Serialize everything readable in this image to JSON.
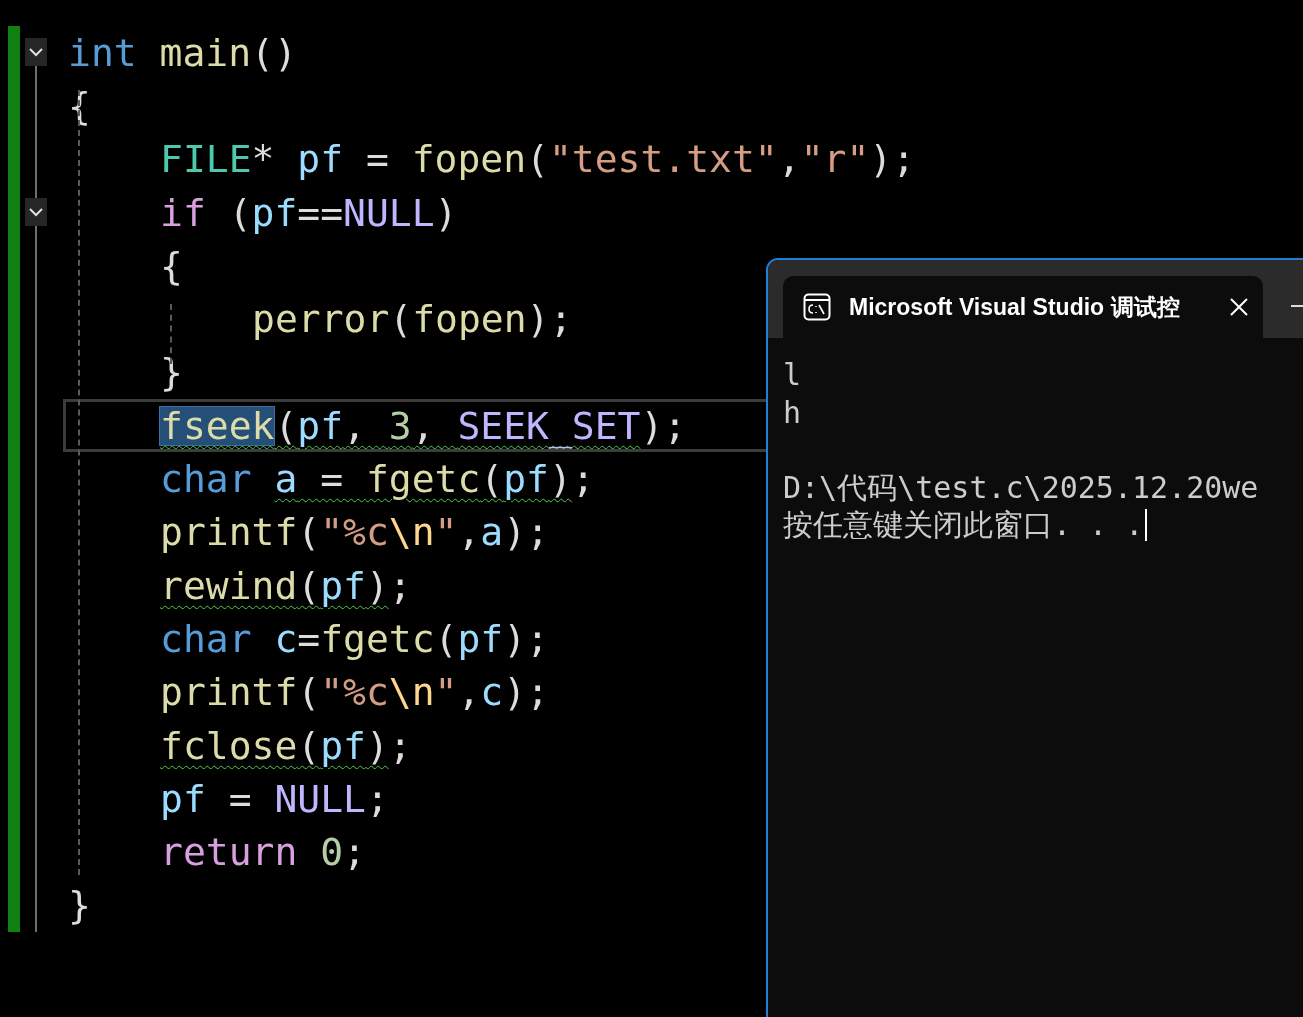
{
  "editor": {
    "lines": [
      {
        "expanded": true,
        "tokens": [
          {
            "text": "int ",
            "kind": "keyword"
          },
          {
            "text": "main",
            "kind": "function"
          },
          {
            "text": "()",
            "kind": "punct"
          }
        ]
      },
      {
        "tokens": [
          {
            "text": "{",
            "kind": "punct"
          }
        ],
        "children": [
          {
            "tokens": [
              {
                "text": "FILE",
                "kind": "type"
              },
              {
                "text": "* ",
                "kind": "punct"
              },
              {
                "text": "pf",
                "kind": "variable"
              },
              {
                "text": " = ",
                "kind": "punct"
              },
              {
                "text": "fopen",
                "kind": "function"
              },
              {
                "text": "(",
                "kind": "punct"
              },
              {
                "text": "\"test.txt\"",
                "kind": "string"
              },
              {
                "text": ",",
                "kind": "punct"
              },
              {
                "text": "\"r\"",
                "kind": "string"
              },
              {
                "text": ");",
                "kind": "punct"
              }
            ]
          },
          {
            "expanded": true,
            "tokens": [
              {
                "text": "if",
                "kind": "control"
              },
              {
                "text": " (",
                "kind": "punct"
              },
              {
                "text": "pf",
                "kind": "variable"
              },
              {
                "text": "==",
                "kind": "punct"
              },
              {
                "text": "NULL",
                "kind": "macro"
              },
              {
                "text": ")",
                "kind": "punct"
              }
            ]
          },
          {
            "tokens": [
              {
                "text": "{",
                "kind": "punct"
              }
            ],
            "children": [
              {
                "tokens": [
                  {
                    "text": "perror",
                    "kind": "function"
                  },
                  {
                    "text": "(",
                    "kind": "punct"
                  },
                  {
                    "text": "fopen",
                    "kind": "function"
                  },
                  {
                    "text": ");",
                    "kind": "punct"
                  }
                ]
              }
            ]
          },
          {
            "tokens": [
              {
                "text": "}",
                "kind": "punct"
              }
            ]
          },
          {
            "current": true,
            "tokens": [
              {
                "text": "fseek",
                "kind": "function",
                "selected": true,
                "squiggle": true
              },
              {
                "text": "(",
                "kind": "punct",
                "squiggle": true
              },
              {
                "text": "pf",
                "kind": "variable",
                "squiggle": true
              },
              {
                "text": ", ",
                "kind": "punct",
                "squiggle": true
              },
              {
                "text": "3",
                "kind": "number",
                "squiggle": true
              },
              {
                "text": ", ",
                "kind": "punct",
                "squiggle": true
              },
              {
                "text": "SEEK_SET",
                "kind": "macro",
                "squiggle": true
              },
              {
                "text": ");",
                "kind": "punct",
                "squiggle": false
              }
            ]
          },
          {
            "tokens": [
              {
                "text": "char ",
                "kind": "keyword"
              },
              {
                "text": "a",
                "kind": "variable",
                "squiggle": true
              },
              {
                "text": " = ",
                "kind": "punct",
                "squiggle": true
              },
              {
                "text": "fgetc",
                "kind": "function",
                "squiggle": true
              },
              {
                "text": "(",
                "kind": "punct",
                "squiggle": true
              },
              {
                "text": "pf",
                "kind": "variable",
                "squiggle": true
              },
              {
                "text": ")",
                "kind": "punct",
                "squiggle": true
              },
              {
                "text": ";",
                "kind": "punct"
              }
            ]
          },
          {
            "tokens": [
              {
                "text": "printf",
                "kind": "function"
              },
              {
                "text": "(",
                "kind": "punct"
              },
              {
                "text": "\"%c",
                "kind": "string"
              },
              {
                "text": "\\n",
                "kind": "escape"
              },
              {
                "text": "\"",
                "kind": "string"
              },
              {
                "text": ",",
                "kind": "punct"
              },
              {
                "text": "a",
                "kind": "variable"
              },
              {
                "text": ");",
                "kind": "punct"
              }
            ]
          },
          {
            "tokens": [
              {
                "text": "rewind",
                "kind": "function",
                "squiggle": true
              },
              {
                "text": "(",
                "kind": "punct",
                "squiggle": true
              },
              {
                "text": "pf",
                "kind": "variable",
                "squiggle": true
              },
              {
                "text": ")",
                "kind": "punct",
                "squiggle": true
              },
              {
                "text": ";",
                "kind": "punct"
              }
            ]
          },
          {
            "tokens": [
              {
                "text": "char ",
                "kind": "keyword"
              },
              {
                "text": "c",
                "kind": "variable"
              },
              {
                "text": "=",
                "kind": "punct"
              },
              {
                "text": "fgetc",
                "kind": "function"
              },
              {
                "text": "(",
                "kind": "punct"
              },
              {
                "text": "pf",
                "kind": "variable"
              },
              {
                "text": ");",
                "kind": "punct"
              }
            ]
          },
          {
            "tokens": [
              {
                "text": "printf",
                "kind": "function"
              },
              {
                "text": "(",
                "kind": "punct"
              },
              {
                "text": "\"%c",
                "kind": "string"
              },
              {
                "text": "\\n",
                "kind": "escape"
              },
              {
                "text": "\"",
                "kind": "string"
              },
              {
                "text": ",",
                "kind": "punct"
              },
              {
                "text": "c",
                "kind": "variable"
              },
              {
                "text": ");",
                "kind": "punct"
              }
            ]
          },
          {
            "tokens": [
              {
                "text": "fclose",
                "kind": "function",
                "squiggle": true
              },
              {
                "text": "(",
                "kind": "punct",
                "squiggle": true
              },
              {
                "text": "pf",
                "kind": "variable",
                "squiggle": true
              },
              {
                "text": ")",
                "kind": "punct",
                "squiggle": true
              },
              {
                "text": ";",
                "kind": "punct"
              }
            ]
          },
          {
            "tokens": [
              {
                "text": "pf",
                "kind": "variable"
              },
              {
                "text": " = ",
                "kind": "punct"
              },
              {
                "text": "NULL",
                "kind": "macro"
              },
              {
                "text": ";",
                "kind": "punct"
              }
            ]
          },
          {
            "tokens": [
              {
                "text": "return ",
                "kind": "control"
              },
              {
                "text": "0",
                "kind": "number"
              },
              {
                "text": ";",
                "kind": "punct"
              }
            ]
          }
        ]
      },
      {
        "tokens": [
          {
            "text": "}",
            "kind": "punct"
          }
        ]
      }
    ]
  },
  "console": {
    "tab": {
      "title": "Microsoft Visual Studio 调试控",
      "selected": true
    },
    "output": [
      "l",
      "h",
      "D:\\代码\\test.c\\2025.12.20we",
      "按任意键关闭此窗口. . ."
    ]
  }
}
